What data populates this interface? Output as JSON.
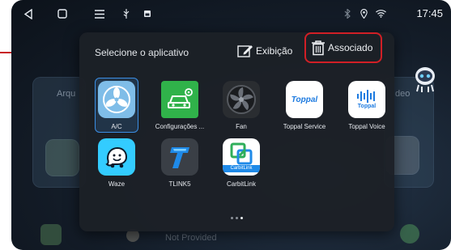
{
  "status_bar": {
    "time": "17:45",
    "icons": [
      "back-icon",
      "home-icon",
      "menu-icon",
      "usb-icon",
      "photo-icon",
      "bluetooth-icon",
      "location-icon",
      "wifi-icon"
    ]
  },
  "background": {
    "card_left_label": "Arqu",
    "card_right_label": "deo",
    "media_text": "Not Provided"
  },
  "dialog": {
    "title": "Selecione o aplicativo",
    "tab_display": "Exibição",
    "tab_associated": "Associado",
    "accent_color": "#d11f26",
    "selected_color": "#3b8ee4",
    "apps": [
      {
        "label": "A/C",
        "icon": "fan-icon",
        "selected": true
      },
      {
        "label": "Configurações ...",
        "icon": "car-settings-icon",
        "selected": false
      },
      {
        "label": "Fan",
        "icon": "fan-dark-icon",
        "selected": false
      },
      {
        "label": "Toppal Service",
        "icon": "toppal-logo-icon",
        "selected": false
      },
      {
        "label": "Toppal Voice",
        "icon": "toppal-voice-icon",
        "selected": false
      },
      {
        "label": "Waze",
        "icon": "waze-icon",
        "selected": false
      },
      {
        "label": "TLINK5",
        "icon": "tlink-icon",
        "selected": false
      },
      {
        "label": "CarbitLink",
        "icon": "carbitlink-icon",
        "selected": false
      }
    ],
    "toppal_text": "Toppal",
    "carbitlink_text": "CarbitLink",
    "page_indicator": {
      "pages": 3,
      "current": 3
    }
  }
}
